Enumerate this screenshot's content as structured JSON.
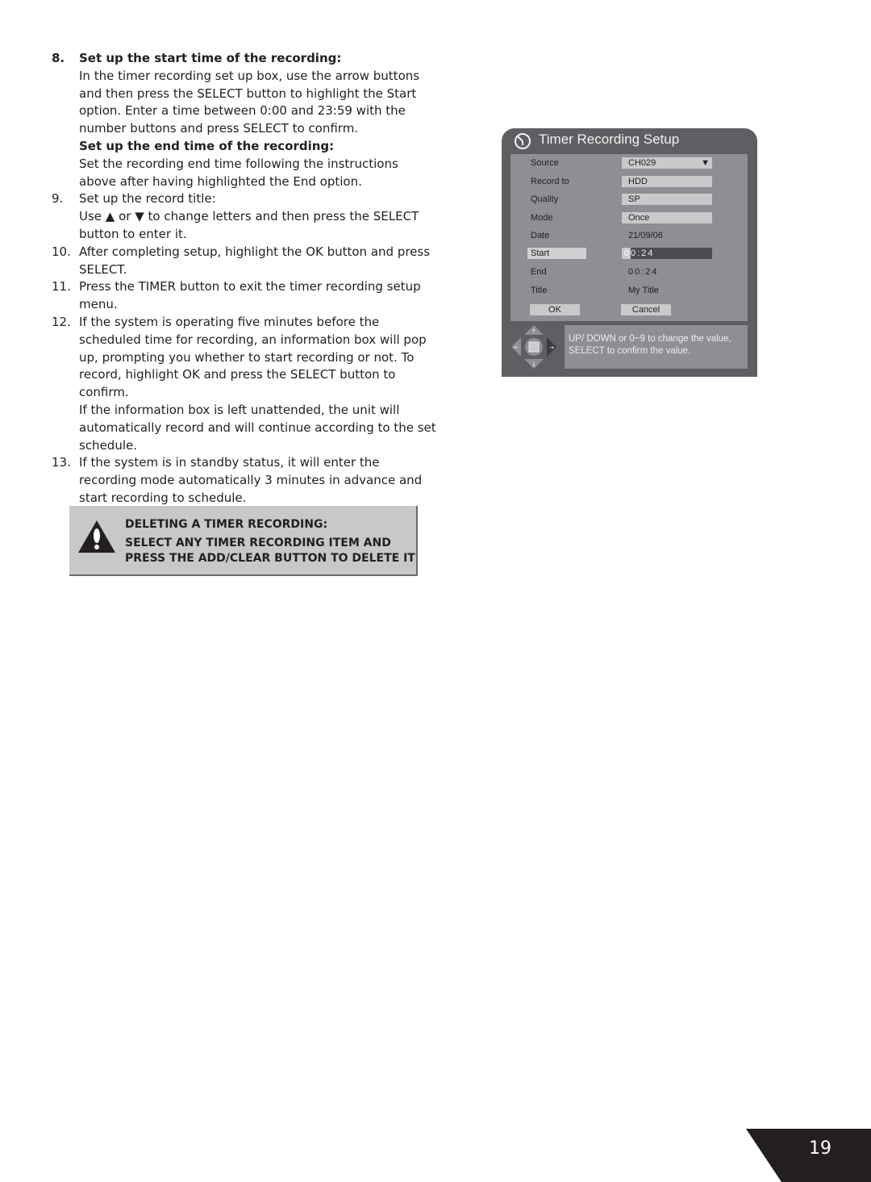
{
  "instructions": [
    {
      "number": "8.",
      "heading": "Set up the start time of the recording:",
      "body": "In the timer recording set up box, use the arrow buttons and then press the SELECT button to highlight the Start option. Enter a time between 0:00 and 23:59 with the number buttons and press SELECT to confirm.",
      "subheading": "Set up the end time of the recording:",
      "subbody": "Set the recording end time following the instructions above after having highlighted the End option."
    },
    {
      "number": "9.",
      "line1": "Set up the record title:",
      "line2_pre": "Use ",
      "up_glyph": "▲",
      "line2_mid": " or ",
      "down_glyph": "▼",
      "line2_post": " to change letters and then press the SELECT button to enter it."
    },
    {
      "number": "10.",
      "text": "After completing setup, highlight the OK button and press SELECT."
    },
    {
      "number": "11.",
      "text": "Press the TIMER button to exit the timer recording setup menu."
    },
    {
      "number": "12.",
      "text": "If the system is operating five minutes before the scheduled time for recording, an information box will pop up, prompting you whether to start recording or not. To record, highlight OK and press the SELECT button to confirm.",
      "text2": "If the information box is left unattended, the unit will automatically record and will continue according to the set schedule."
    },
    {
      "number": "13.",
      "text": "If the system is in standby status, it will enter the recording mode automatically 3 minutes in advance and start recording to schedule."
    }
  ],
  "note": {
    "icon": "warning-icon",
    "title": "DELETING A TIMER RECORDING:",
    "line1": "SELECT ANY TIMER RECORDING ITEM AND",
    "line2": "PRESS THE ADD/CLEAR BUTTON TO DELETE IT"
  },
  "dialog": {
    "title": "Timer Recording Setup",
    "icon": "timer-icon",
    "fields": {
      "source": {
        "label": "Source",
        "value": "CH029",
        "caret": "▼"
      },
      "record_to": {
        "label": "Record to",
        "value": "HDD"
      },
      "quality": {
        "label": "Quality",
        "value": "SP"
      },
      "mode": {
        "label": "Mode",
        "value": "Once"
      },
      "date": {
        "label": "Date",
        "value": "21/09/06"
      },
      "start": {
        "label": "Start",
        "value_cursor": "0",
        "value_rest": "0:24"
      },
      "end": {
        "label": "End",
        "value": "00:24"
      },
      "title": {
        "label": "Title",
        "value": "My Title"
      }
    },
    "ok_label": "OK",
    "cancel_label": "Cancel",
    "hint_line1": "UP/ DOWN or 0~9 to change the value,",
    "hint_line2": "SELECT to confirm the value."
  },
  "colors": {
    "dialog_frame": "#5e5e63",
    "dialog_panel": "#8e8e93",
    "field_bg": "#c9c9cc",
    "note_bg": "#c8c8c9",
    "page_tab": "#231f20"
  },
  "page_number": "19"
}
